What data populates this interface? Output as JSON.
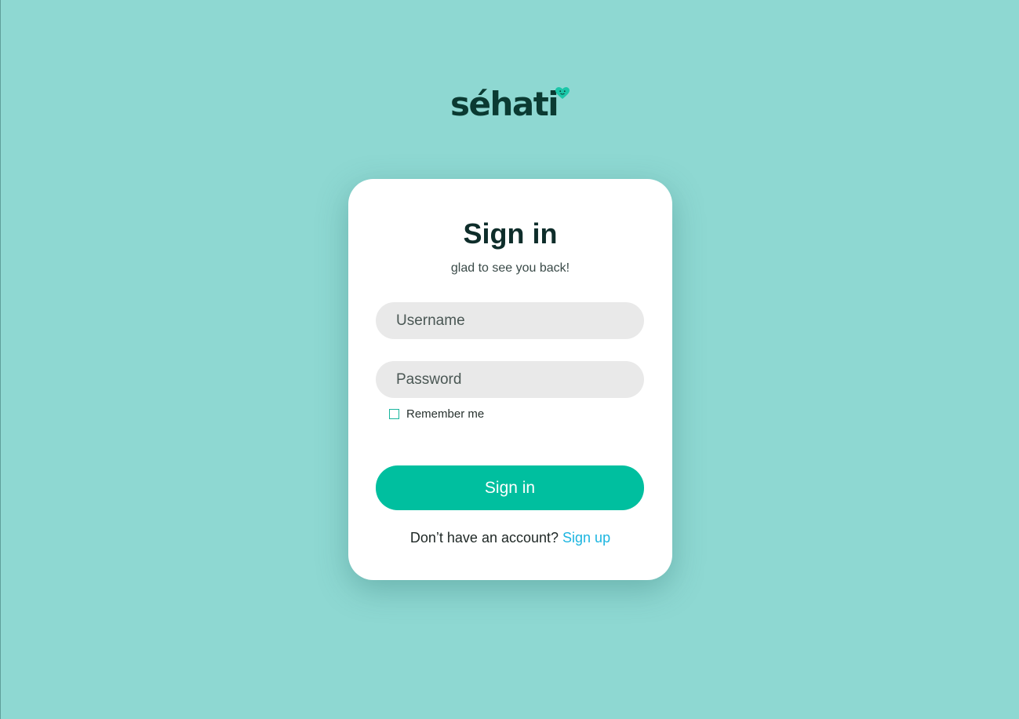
{
  "brand": {
    "logo_text": "séhati",
    "text_color": "#0B3A32",
    "heart_color": "#1BC6A8"
  },
  "background_color": "#8ED8D2",
  "card": {
    "title": "Sign in",
    "subtitle": "glad to see you back!",
    "username": {
      "placeholder": "Username",
      "value": ""
    },
    "password": {
      "placeholder": "Password",
      "value": ""
    },
    "remember_me": {
      "label": "Remember me",
      "checked": false
    },
    "submit_label": "Sign in",
    "footer": {
      "prompt": "Don’t have an account?",
      "link_label": "Sign up"
    }
  },
  "colors": {
    "accent": "#00BF9F",
    "link": "#1CB5E0",
    "input_bg": "#E9E9E9"
  }
}
